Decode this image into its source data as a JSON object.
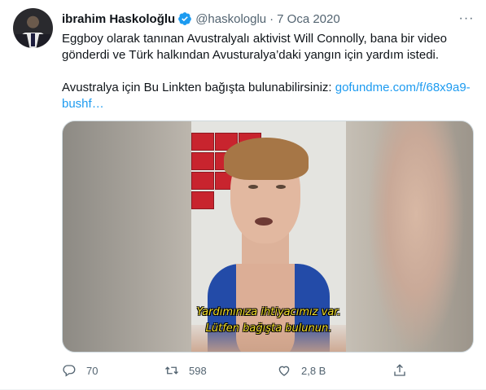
{
  "tweet": {
    "author_name": "ibrahim Haskoloğlu",
    "handle": "@haskologlu",
    "separator": "·",
    "date": "7 Oca 2020",
    "more_label": "···",
    "line1": "Eggboy olarak tanınan Avustralyalı aktivist Will Connolly, bana bir video gönderdi ve Türk halkından Avusturalya’daki yangın için yardım istedi.",
    "line2_text": "Avustralya için Bu Linkten bağışta bulunabilirsiniz: ",
    "line2_link": "gofundme.com/f/68x9a9-bushf…",
    "video_subtitle_1": "Yardımınıza ihtiyacımız var.",
    "video_subtitle_2": "Lütfen bağışta bulunun."
  },
  "actions": {
    "reply_count": "70",
    "retweet_count": "598",
    "like_count": "2,8 B"
  },
  "colors": {
    "link": "#1d9bf0",
    "verified": "#1d9bf0",
    "muted": "#536471"
  },
  "icons": [
    "verified-badge-icon",
    "more-icon",
    "reply-icon",
    "retweet-icon",
    "like-icon",
    "share-icon"
  ]
}
